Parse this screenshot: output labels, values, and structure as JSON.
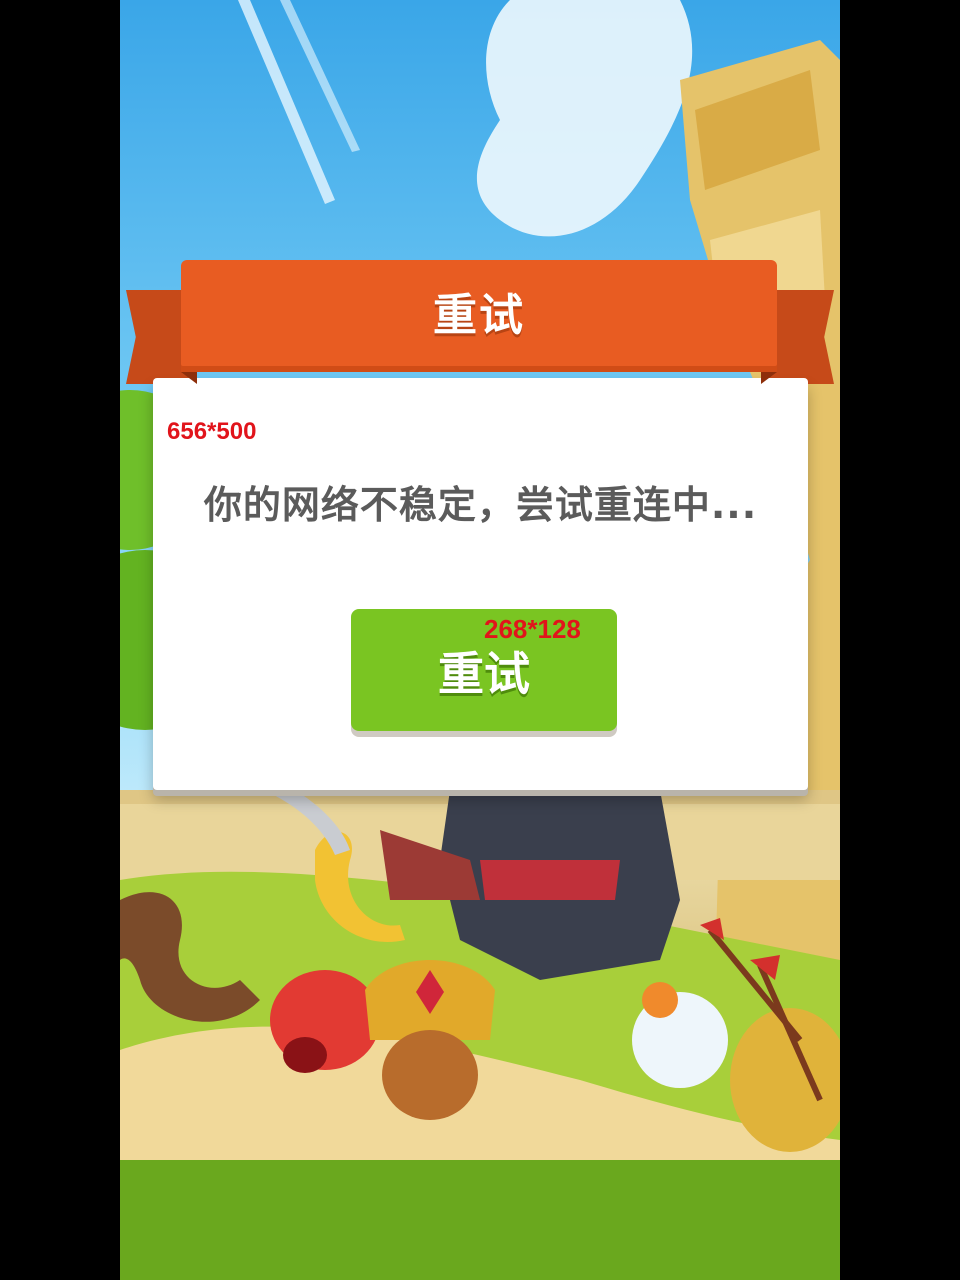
{
  "dialog": {
    "title": "重试",
    "size_annotation": "656*500",
    "message": "你的网络不稳定，尝试重连中...",
    "retry_button": {
      "label": "重试",
      "size_annotation": "268*128"
    }
  },
  "colors": {
    "ribbon": "#e85c22",
    "ribbon_shadow": "#c64a19",
    "dialog_bg": "#ffffff",
    "message_text": "#5b5b5b",
    "button_green": "#7ac522",
    "annotation_red": "#e1141b"
  }
}
